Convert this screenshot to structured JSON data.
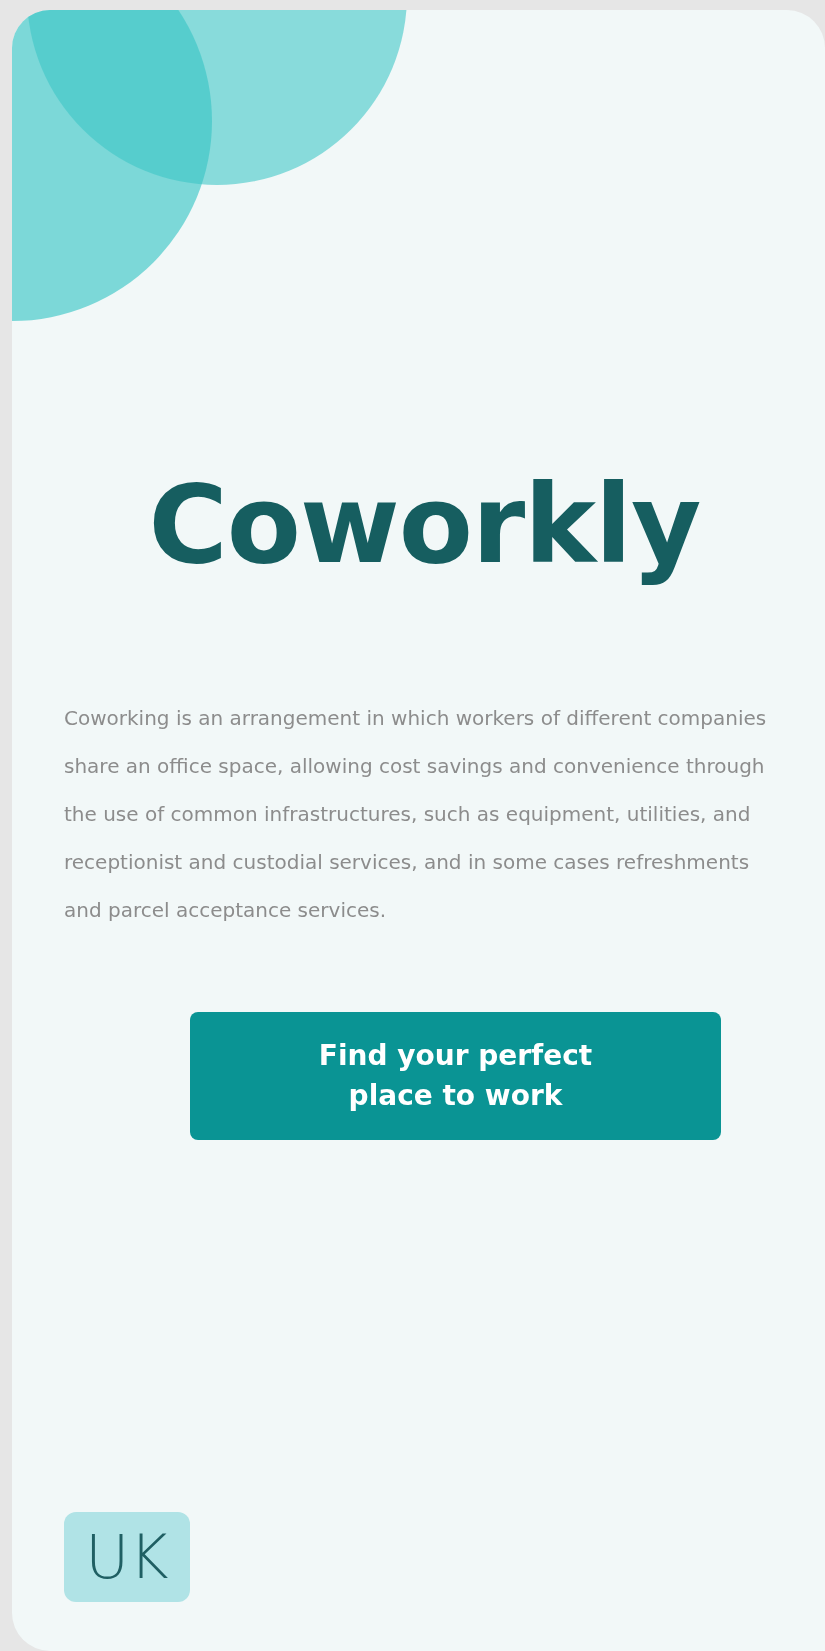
{
  "app": {
    "title": "Coworkly"
  },
  "description": "Coworking is an arrangement in which workers of different companies share an office space, allowing cost savings and convenience through the use of common infrastructures, such as equipment, utilities, and receptionist and custodial services, and in some cases refreshments and parcel acceptance services.",
  "cta_button": {
    "label": "Find your perfect place to work"
  },
  "language_button": {
    "label": "UK"
  }
}
